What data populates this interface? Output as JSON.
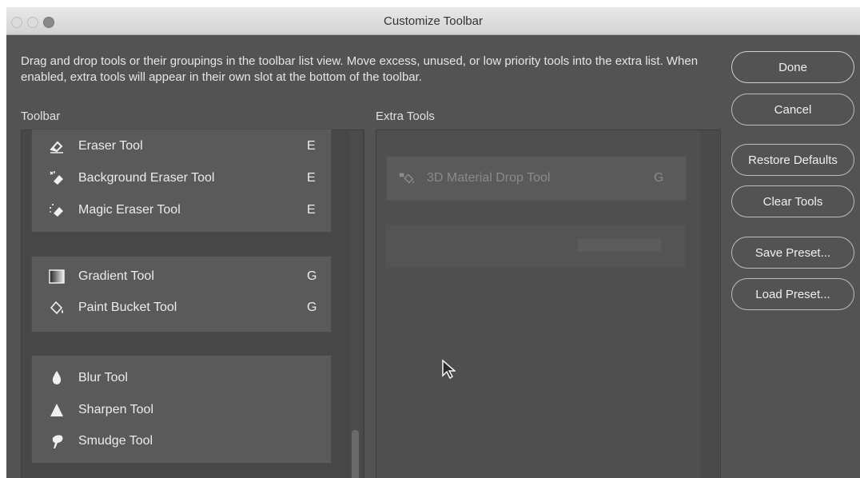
{
  "window": {
    "title": "Customize Toolbar"
  },
  "description": "Drag and drop tools or their groupings in the toolbar list view. Move excess, unused, or low priority tools into the extra list. When enabled, extra tools will appear in their own slot at the bottom of the toolbar.",
  "toolbar": {
    "label": "Toolbar",
    "groups": [
      {
        "tools": [
          {
            "name": "Eraser Tool",
            "key": "E",
            "icon": "eraser-icon"
          },
          {
            "name": "Background Eraser Tool",
            "key": "E",
            "icon": "background-eraser-icon"
          },
          {
            "name": "Magic Eraser Tool",
            "key": "E",
            "icon": "magic-eraser-icon"
          }
        ]
      },
      {
        "tools": [
          {
            "name": "Gradient Tool",
            "key": "G",
            "icon": "gradient-icon"
          },
          {
            "name": "Paint Bucket Tool",
            "key": "G",
            "icon": "paint-bucket-icon"
          }
        ]
      },
      {
        "tools": [
          {
            "name": "Blur Tool",
            "key": "",
            "icon": "blur-icon"
          },
          {
            "name": "Sharpen Tool",
            "key": "",
            "icon": "sharpen-icon"
          },
          {
            "name": "Smudge Tool",
            "key": "",
            "icon": "smudge-icon"
          }
        ]
      }
    ]
  },
  "extra_tools": {
    "label": "Extra Tools",
    "items": [
      {
        "name": "3D Material Drop Tool",
        "key": "G",
        "icon": "3d-material-drop-icon"
      }
    ]
  },
  "buttons": {
    "done": "Done",
    "cancel": "Cancel",
    "restore_defaults": "Restore Defaults",
    "clear_tools": "Clear Tools",
    "save_preset": "Save Preset...",
    "load_preset": "Load Preset..."
  }
}
